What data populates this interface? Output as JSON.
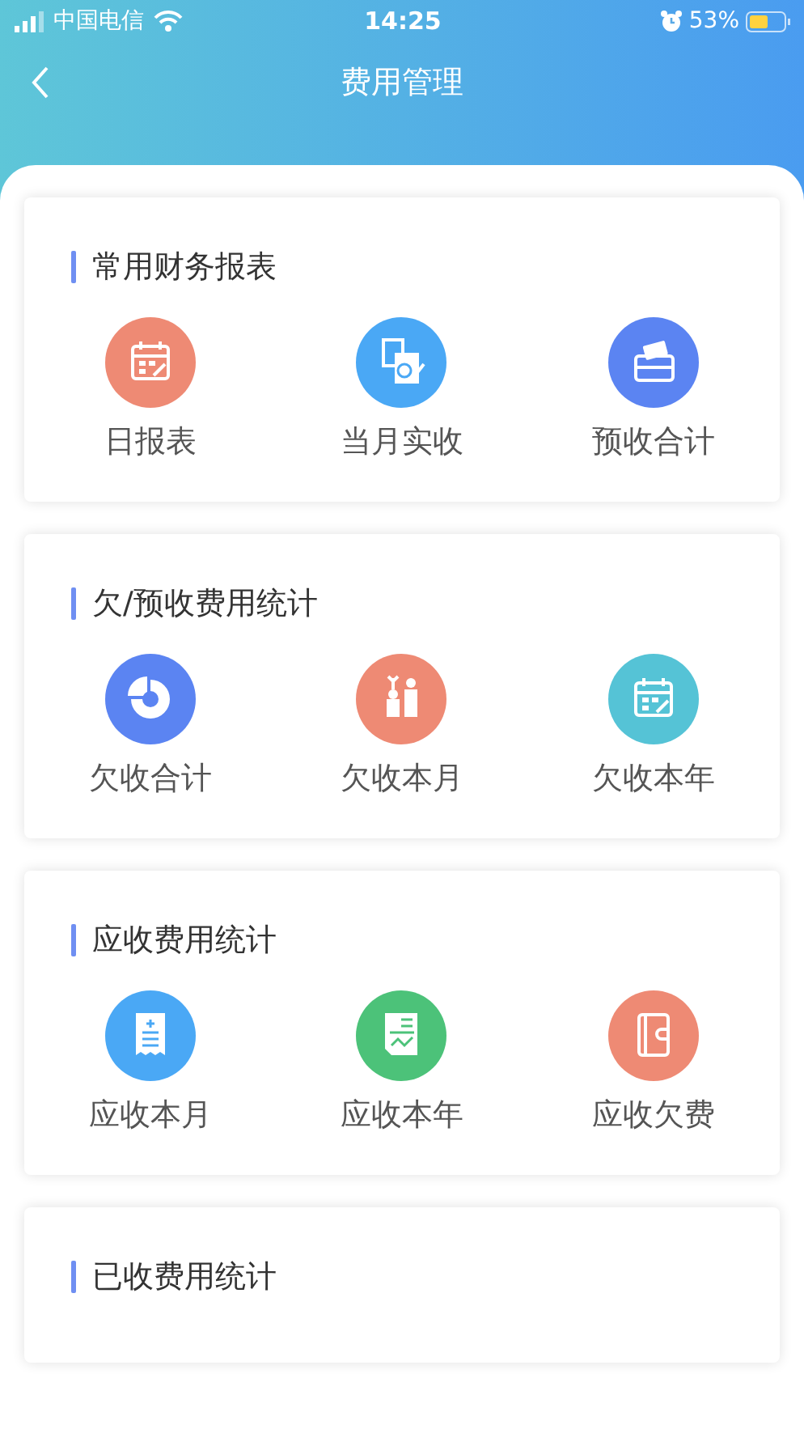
{
  "status_bar": {
    "carrier": "中国电信",
    "time": "14:25",
    "battery": "53%"
  },
  "nav": {
    "title": "费用管理"
  },
  "sections": [
    {
      "title": "常用财务报表",
      "items": [
        {
          "label": "日报表",
          "kind": "calendar",
          "color": "#ee8a74"
        },
        {
          "label": "当月实收",
          "kind": "ledger",
          "color": "#4aa8f5"
        },
        {
          "label": "预收合计",
          "kind": "card",
          "color": "#5b84f2"
        }
      ]
    },
    {
      "title": "欠/预收费用统计",
      "items": [
        {
          "label": "欠收合计",
          "kind": "pie",
          "color": "#5b84f2"
        },
        {
          "label": "欠收本月",
          "kind": "coins",
          "color": "#ee8a74"
        },
        {
          "label": "欠收本年",
          "kind": "calendar",
          "color": "#55c3d6"
        }
      ]
    },
    {
      "title": "应收费用统计",
      "items": [
        {
          "label": "应收本月",
          "kind": "receipt",
          "color": "#4aa8f5"
        },
        {
          "label": "应收本年",
          "kind": "chart",
          "color": "#4cc279"
        },
        {
          "label": "应收欠费",
          "kind": "wallet",
          "color": "#ee8a74"
        }
      ]
    },
    {
      "title": "已收费用统计"
    }
  ]
}
